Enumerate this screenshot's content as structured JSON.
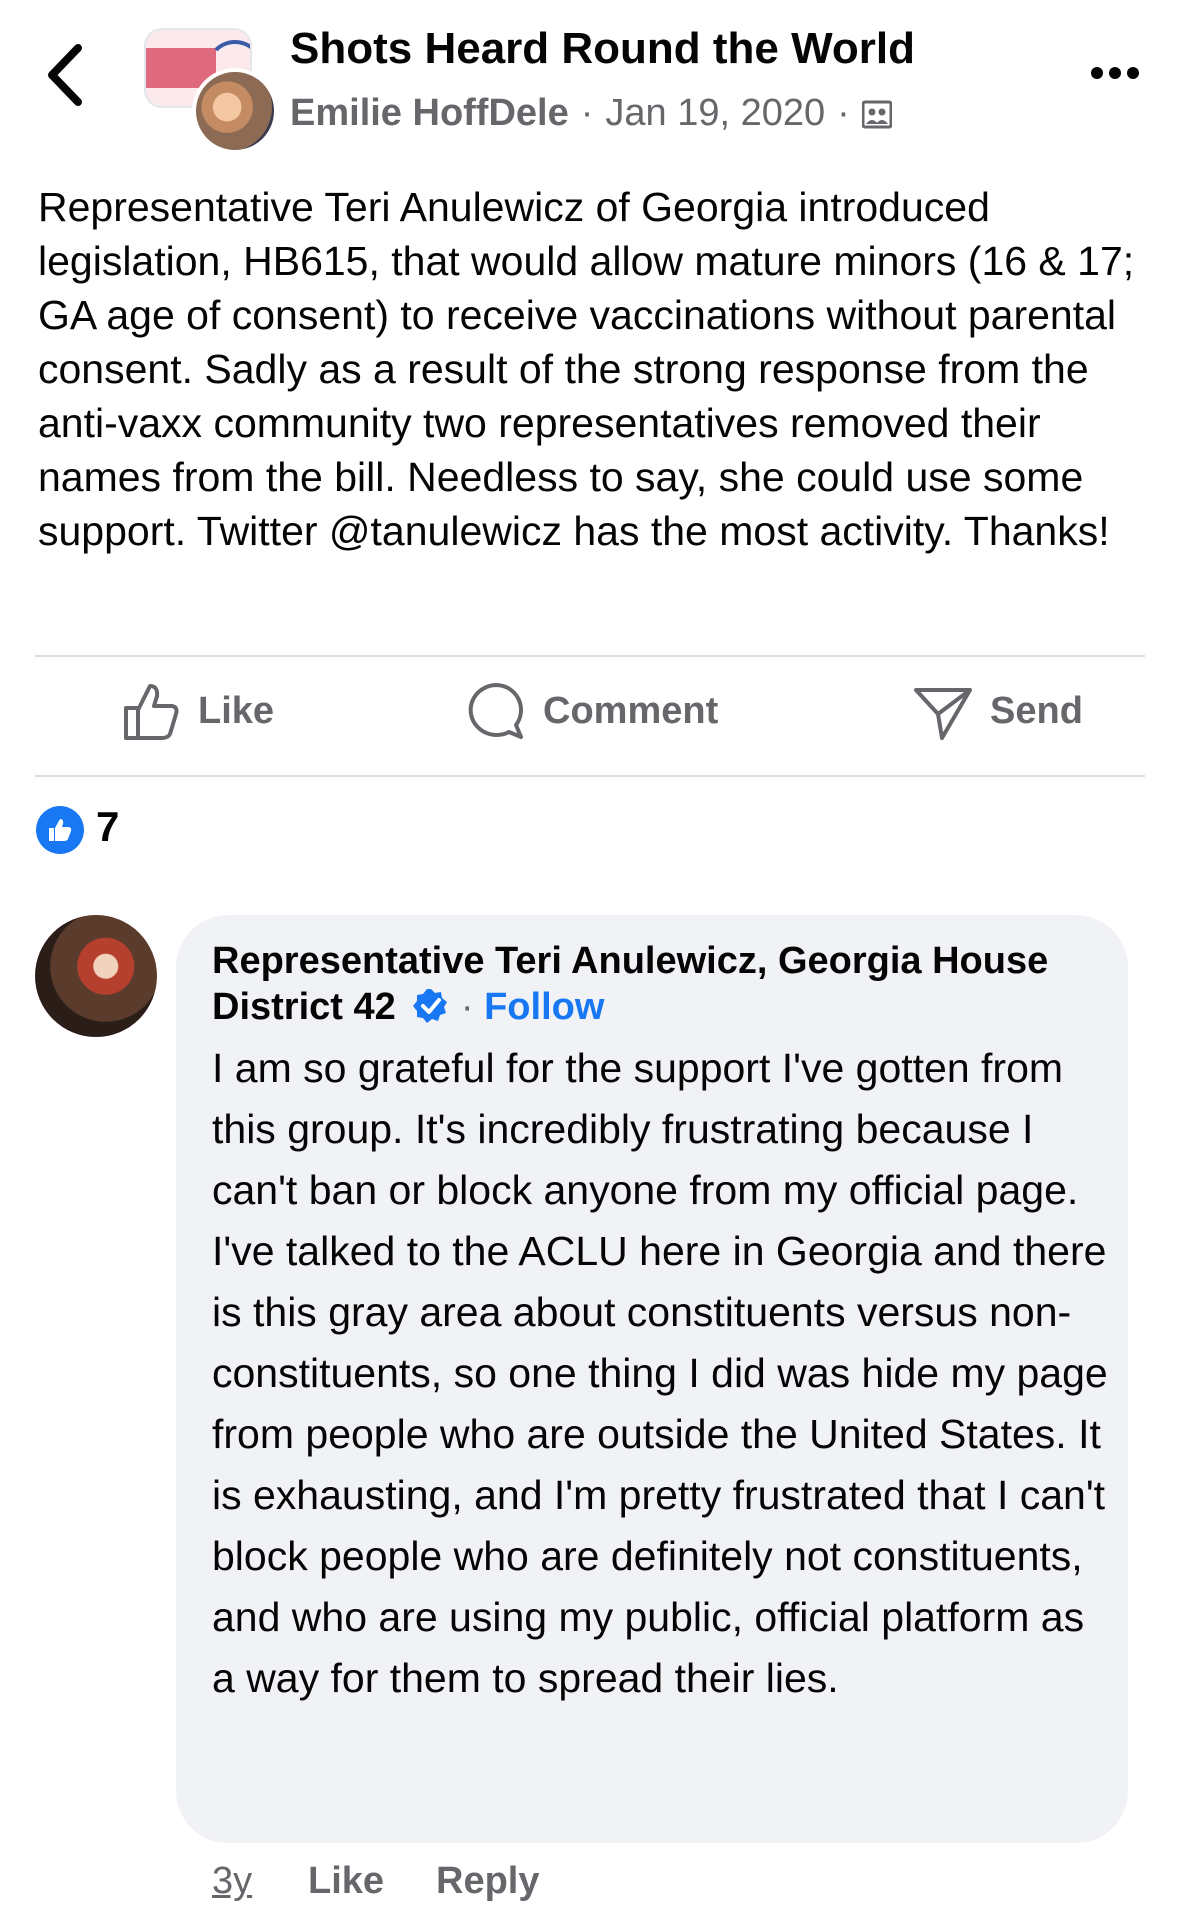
{
  "header": {
    "group_title": "Shots Heard Round the World",
    "author": "Emilie HoffDele",
    "date": "Jan 19, 2020",
    "separator": "·",
    "audience_icon": "group-members-icon",
    "back_icon": "chevron-left-icon",
    "more_icon": "ellipsis-icon"
  },
  "post": {
    "text": "Representative Teri Anulewicz of Georgia introduced legislation, HB615, that would allow mature minors (16 & 17; GA age of consent) to receive vaccinations without parental consent. Sadly as a result of the strong response from the anti-vaxx community two representatives removed their names from the bill. Needless to say, she could use some support. Twitter @tanulewicz has the most activity. Thanks!"
  },
  "actions": {
    "like": "Like",
    "comment": "Comment",
    "send": "Send"
  },
  "reactions": {
    "count": "7",
    "icon": "thumbs-up-icon"
  },
  "comment": {
    "author": "Representative Teri Anulewicz, Georgia House District 42",
    "follow": "Follow",
    "dot": "·",
    "text": "I am so grateful for the support I've gotten from this group. It's incredibly frustrating because I can't ban or block anyone from my official page. I've talked to the ACLU here in Georgia and there is this gray area about constituents versus non-constituents, so one thing I did was hide my page from people who are outside the United States. It is exhausting, and I'm pretty frustrated that I can't block people who are definitely not constituents, and who are using my public, official platform as a way for them to spread their lies.",
    "time": "3y",
    "like": "Like",
    "reply": "Reply"
  },
  "colors": {
    "accent": "#1877f2",
    "secondary_text": "#65676b",
    "bubble": "#f0f2f5"
  }
}
